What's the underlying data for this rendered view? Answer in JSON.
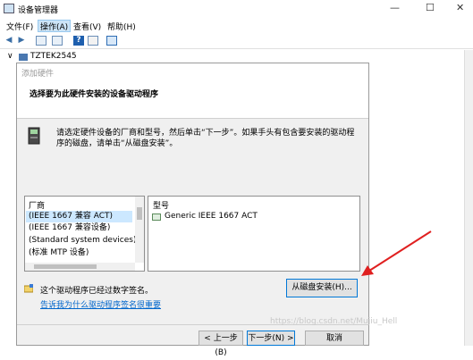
{
  "window": {
    "title": "设备管理器",
    "controls": [
      "—",
      "☐",
      "✕"
    ]
  },
  "menu": {
    "file": "文件(F)",
    "action": "操作(A)",
    "view": "查看(V)",
    "help": "帮助(H)"
  },
  "tree": {
    "root_label": "TZTEK2545",
    "expander": "∨"
  },
  "dialog": {
    "title": "添加硬件",
    "heading": "选择要为此硬件安装的设备驱动程序",
    "description": "请选定硬件设备的厂商和型号，然后单击“下一步”。如果手头有包含要安装的驱动程序的磁盘，请单击“从磁盘安装”。",
    "manufacturer_header": "厂商",
    "manufacturers": [
      {
        "label": "(IEEE 1667 兼容 ACT)",
        "selected": true
      },
      {
        "label": "(IEEE 1667 兼容设备)",
        "selected": false
      },
      {
        "label": "(Standard system devices)",
        "selected": false
      },
      {
        "label": "(标准 MTP 设备)",
        "selected": false
      }
    ],
    "model_header": "型号",
    "models": [
      {
        "label": "Generic IEEE 1667 ACT",
        "selected": false
      }
    ],
    "signed_note": "这个驱动程序已经过数字签名。",
    "signing_link": "告诉我为什么驱动程序签名很重要",
    "have_disk_button": "从磁盘安装(H)...",
    "back_button": "< 上一步(B)",
    "next_button": "下一步(N) >",
    "cancel_button": "取消"
  },
  "watermark": "https://blog.csdn.net/Mujiu_Hell",
  "colors": {
    "accent": "#0078d7",
    "selection": "#cce8ff",
    "annotation_arrow": "#e02020",
    "link": "#0066cc"
  },
  "icons": {
    "hardware": "hardware-device-icon",
    "shield": "signature-shield-icon",
    "driver": "driver-model-icon"
  }
}
